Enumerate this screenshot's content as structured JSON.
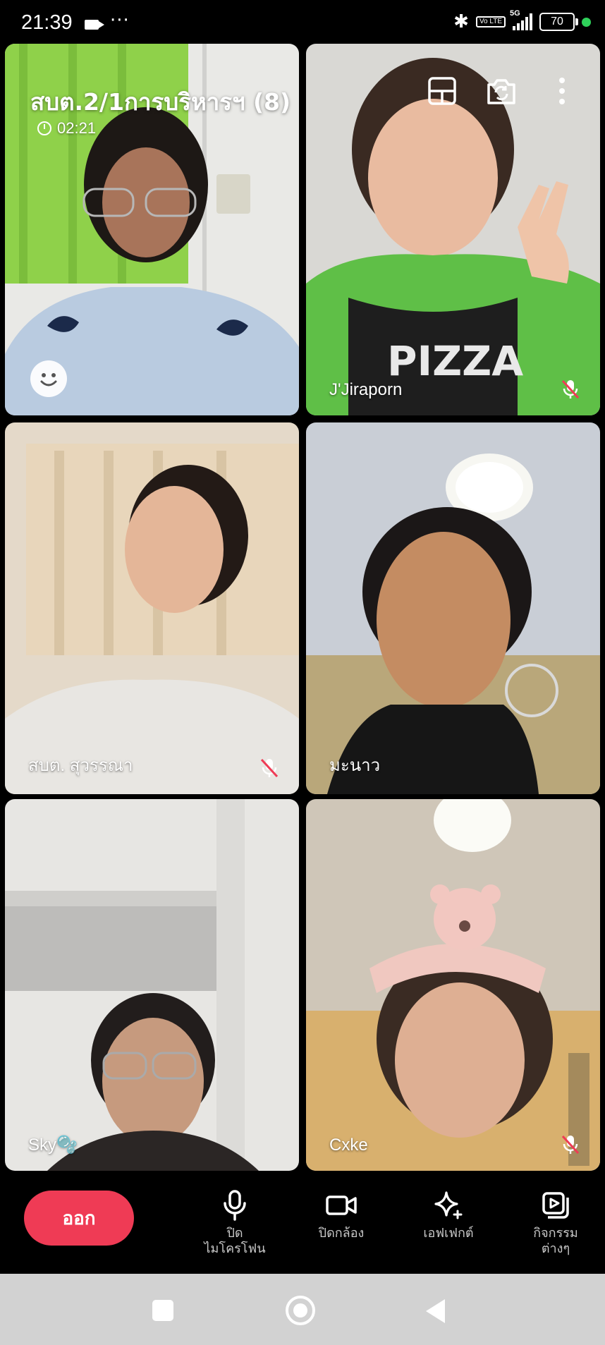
{
  "status_bar": {
    "time": "21:39",
    "network": "5G",
    "volte": "Vo LTE",
    "battery": "70",
    "icons": [
      "video-call-icon",
      "more-dots-icon",
      "bluetooth-icon",
      "volte-icon",
      "signal-icon",
      "battery-icon",
      "active-dot-icon"
    ]
  },
  "call": {
    "room_title": "สบต.2/1การบริหารฯ (8)",
    "duration": "02:21"
  },
  "participants": [
    {
      "name": "",
      "muted": false,
      "self": true
    },
    {
      "name": "J'Jiraporn",
      "muted": true
    },
    {
      "name": "สบต. สุวรรณา",
      "muted": true
    },
    {
      "name": "มะนาว",
      "muted": false
    },
    {
      "name": "Sky🫧",
      "muted": false
    },
    {
      "name": "Cxke",
      "muted": true
    }
  ],
  "top_tools": [
    "layout-icon",
    "switch-camera-icon",
    "more-vertical-icon"
  ],
  "controls": {
    "leave": "ออก",
    "mic": "ปิด\nไมโครโฟน",
    "camera": "ปิดกล้อง",
    "effects": "เอฟเฟกต์",
    "activities": "กิจกรรม\nต่างๆ"
  },
  "colors": {
    "leave_button": "#ef3b55",
    "background": "#000000",
    "nav_bar": "#d2d2d2",
    "active_dot": "#2fd15a"
  }
}
